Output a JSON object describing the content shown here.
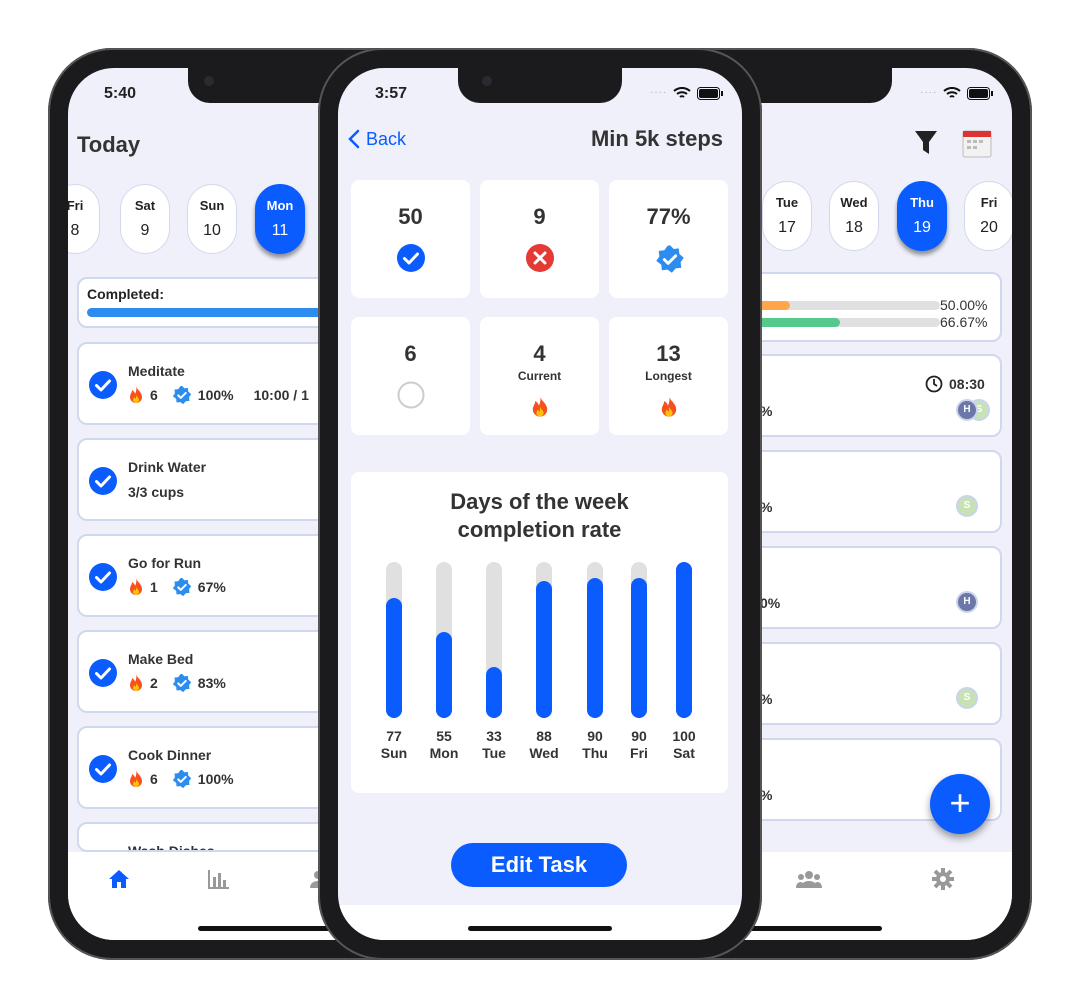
{
  "left_phone": {
    "status_time": "5:40",
    "title": "Today",
    "days": [
      {
        "day": "Fri",
        "date": "8"
      },
      {
        "day": "Sat",
        "date": "9"
      },
      {
        "day": "Sun",
        "date": "10"
      },
      {
        "day": "Mon",
        "date": "11",
        "selected": true
      }
    ],
    "completed_label": "Completed:",
    "completed_progress_pct": 100,
    "tasks": [
      {
        "name": "Meditate",
        "streak": "6",
        "rate": "100%",
        "extra": "10:00 / 1"
      },
      {
        "name": "Drink Water",
        "subtitle": "3/3 cups"
      },
      {
        "name": "Go for Run",
        "streak": "1",
        "rate": "67%"
      },
      {
        "name": "Make Bed",
        "streak": "2",
        "rate": "83%"
      },
      {
        "name": "Cook Dinner",
        "streak": "6",
        "rate": "100%"
      },
      {
        "name": "Wash Dishes"
      }
    ],
    "tabs": [
      "home-icon",
      "bar-chart-icon",
      "people-icon"
    ],
    "accent": "#0a5cff"
  },
  "middle_phone": {
    "status_time": "3:57",
    "back_label": "Back",
    "title": "Min 5k steps",
    "stats": [
      {
        "value": "50",
        "icon": "check-circle-icon"
      },
      {
        "value": "9",
        "icon": "x-circle-icon"
      },
      {
        "value": "77%",
        "icon": "verified-badge-icon"
      },
      {
        "value": "6",
        "icon": "empty-circle-icon"
      },
      {
        "value": "4",
        "label": "Current",
        "icon": "flame-icon"
      },
      {
        "value": "13",
        "label": "Longest",
        "icon": "flame-icon"
      }
    ],
    "edit_button": "Edit Task"
  },
  "chart_data": {
    "type": "bar",
    "title_line1": "Days of the week",
    "title_line2": "completion rate",
    "categories": [
      "Sun",
      "Mon",
      "Tue",
      "Wed",
      "Thu",
      "Fri",
      "Sat"
    ],
    "values": [
      77,
      55,
      33,
      88,
      90,
      90,
      100
    ],
    "ylim": [
      0,
      100
    ],
    "bar_color": "#0a5cff",
    "track_color": "#e0e0e0",
    "grid": false
  },
  "right_phone": {
    "days": [
      {
        "day": "Tue",
        "date": "17"
      },
      {
        "day": "Wed",
        "date": "18"
      },
      {
        "day": "Thu",
        "date": "19",
        "selected": true
      },
      {
        "day": "Fri",
        "date": "20"
      }
    ],
    "progress": [
      {
        "value": "50.00%",
        "pct": 50,
        "color": "#ffa64d"
      },
      {
        "value": "66.67%",
        "pct": 66.67,
        "color": "#55c98c"
      }
    ],
    "tasks": [
      {
        "fragment": "%",
        "time": "08:30",
        "avatars": [
          "H",
          "S"
        ]
      },
      {
        "fragment": "%",
        "avatars": [
          "S"
        ]
      },
      {
        "fragment": "0%",
        "avatars": [
          "H"
        ]
      },
      {
        "fragment": "%",
        "avatars": [
          "S"
        ]
      },
      {
        "fragment": "%",
        "avatars": []
      }
    ],
    "tabs": [
      "people-icon",
      "gear-icon"
    ],
    "fab": "+"
  }
}
